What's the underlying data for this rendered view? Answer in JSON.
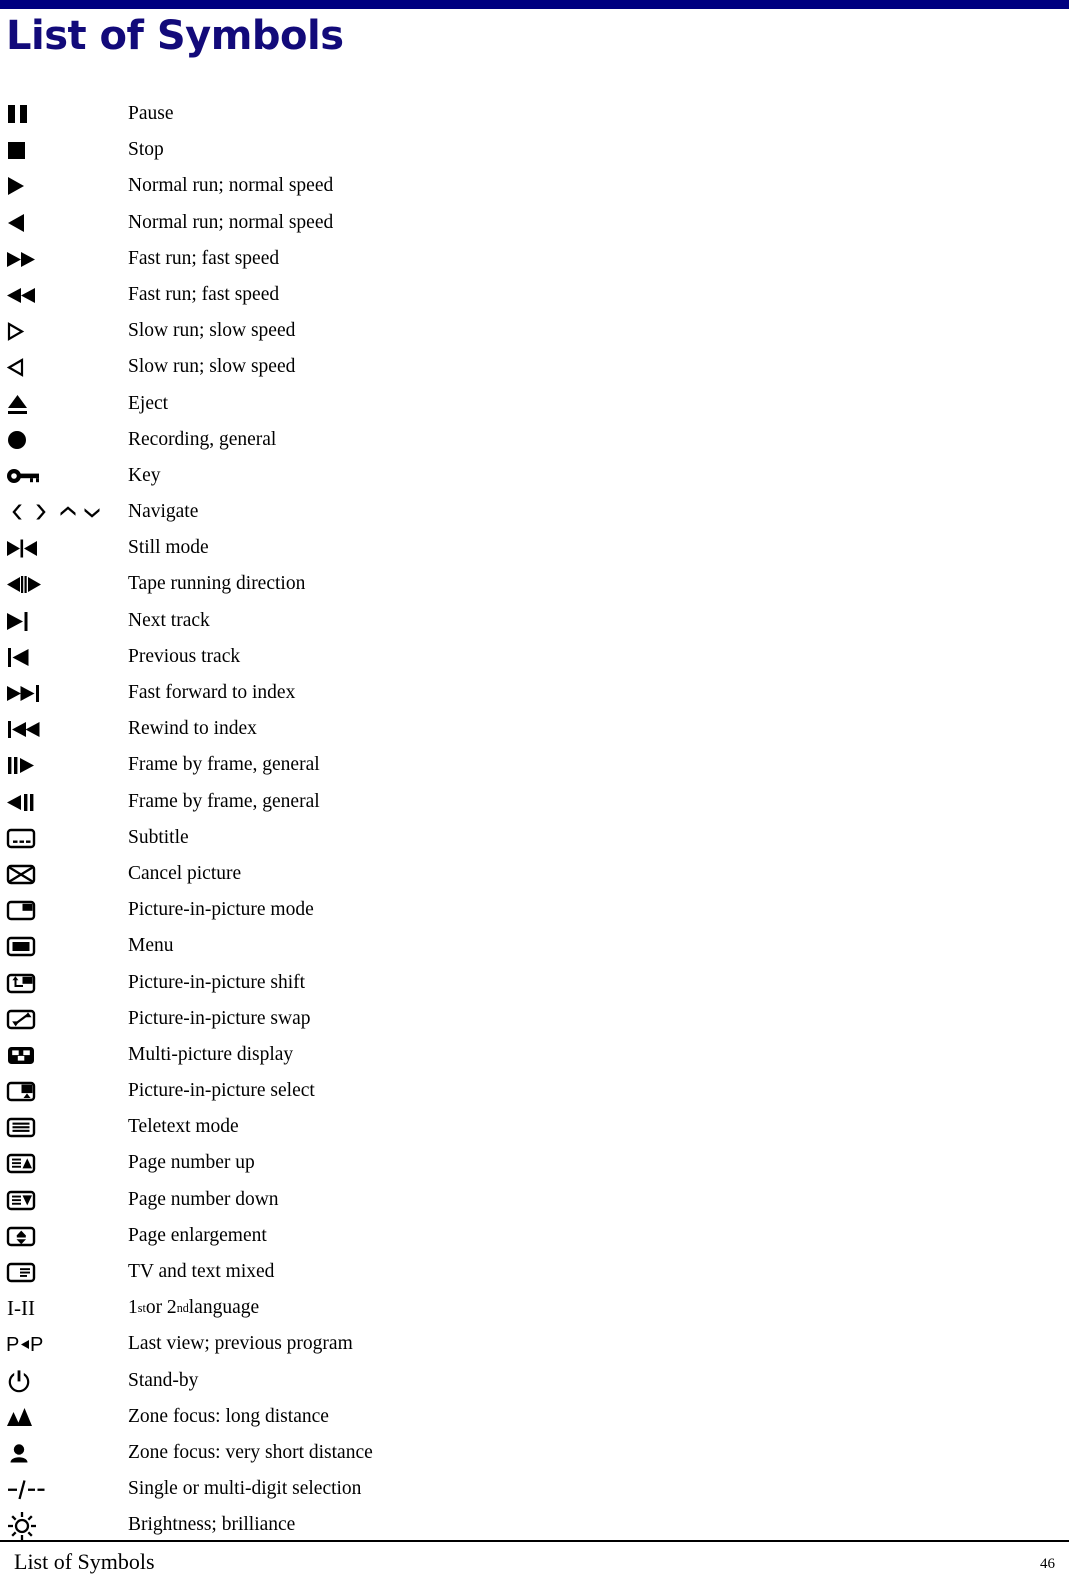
{
  "document": {
    "title": "List of Symbols",
    "title_color": "#120a7a",
    "rule_color": "#000080"
  },
  "footer": {
    "title": "List of Symbols",
    "page_number": "46"
  },
  "symbols": [
    {
      "icon": "pause-icon",
      "label": "Pause"
    },
    {
      "icon": "stop-icon",
      "label": "Stop"
    },
    {
      "icon": "play-right-icon",
      "label": "Normal run; normal speed"
    },
    {
      "icon": "play-left-icon",
      "label": "Normal run; normal speed"
    },
    {
      "icon": "fast-forward-icon",
      "label": "Fast run; fast speed"
    },
    {
      "icon": "fast-rewind-icon",
      "label": "Fast run; fast speed"
    },
    {
      "icon": "slow-play-right-icon",
      "label": "Slow run; slow speed"
    },
    {
      "icon": "slow-play-left-icon",
      "label": "Slow run; slow speed"
    },
    {
      "icon": "eject-icon",
      "label": "Eject"
    },
    {
      "icon": "record-icon",
      "label": "Recording, general"
    },
    {
      "icon": "key-icon",
      "label": "Key"
    },
    {
      "icon": "navigate-icon",
      "label": "Navigate"
    },
    {
      "icon": "still-mode-icon",
      "label": "Still mode"
    },
    {
      "icon": "tape-direction-icon",
      "label": "Tape running direction"
    },
    {
      "icon": "next-track-icon",
      "label": "Next track"
    },
    {
      "icon": "previous-track-icon",
      "label": "Previous track"
    },
    {
      "icon": "fast-forward-to-index-icon",
      "label": "Fast forward to index"
    },
    {
      "icon": "rewind-to-index-icon",
      "label": "Rewind to index"
    },
    {
      "icon": "frame-by-frame-forward-icon",
      "label": "Frame by frame, general"
    },
    {
      "icon": "frame-by-frame-reverse-icon",
      "label": "Frame by frame, general"
    },
    {
      "icon": "subtitle-icon",
      "label": "Subtitle"
    },
    {
      "icon": "cancel-picture-icon",
      "label": "Cancel picture"
    },
    {
      "icon": "picture-in-picture-mode-icon",
      "label": "Picture-in-picture mode"
    },
    {
      "icon": "menu-icon",
      "label": "Menu"
    },
    {
      "icon": "picture-in-picture-shift-icon",
      "label": "Picture-in-picture shift"
    },
    {
      "icon": "picture-in-picture-swap-icon",
      "label": "Picture-in-picture swap"
    },
    {
      "icon": "multi-picture-display-icon",
      "label": "Multi-picture display"
    },
    {
      "icon": "picture-in-picture-select-icon",
      "label": "Picture-in-picture select"
    },
    {
      "icon": "teletext-mode-icon",
      "label": "Teletext mode"
    },
    {
      "icon": "page-number-up-icon",
      "label": "Page number up"
    },
    {
      "icon": "page-number-down-icon",
      "label": "Page number down"
    },
    {
      "icon": "page-enlargement-icon",
      "label": "Page enlargement"
    },
    {
      "icon": "tv-text-mixed-icon",
      "label": "TV and text mixed"
    },
    {
      "icon": "language-select-icon",
      "label": "1st or 2nd language",
      "label_html": "1<sup>st</sup> or 2<sup>nd</sup> language"
    },
    {
      "icon": "last-view-icon",
      "label": "Last view; previous program"
    },
    {
      "icon": "stand-by-icon",
      "label": "Stand-by"
    },
    {
      "icon": "zone-focus-long-icon",
      "label": "Zone focus: long distance"
    },
    {
      "icon": "zone-focus-short-icon",
      "label": "Zone focus: very short distance"
    },
    {
      "icon": "digit-selection-icon",
      "label": "Single or multi-digit selection"
    },
    {
      "icon": "brightness-icon",
      "label": "Brightness; brilliance"
    }
  ]
}
